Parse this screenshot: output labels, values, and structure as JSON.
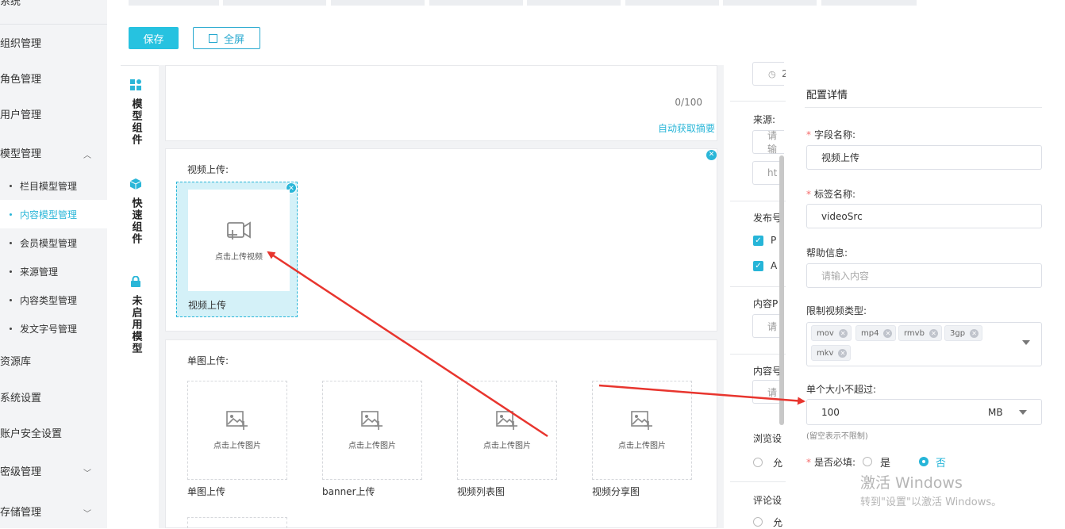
{
  "sidebar": {
    "items": [
      {
        "label": "系统"
      },
      {
        "label": "组织管理"
      },
      {
        "label": "角色管理"
      },
      {
        "label": "用户管理"
      },
      {
        "label": "模型管理"
      },
      {
        "label": "资源库"
      },
      {
        "label": "系统设置"
      },
      {
        "label": "账户安全设置"
      },
      {
        "label": "密级管理"
      },
      {
        "label": "存储管理"
      }
    ],
    "sub_items": [
      {
        "label": "栏目模型管理"
      },
      {
        "label": "内容模型管理"
      },
      {
        "label": "会员模型管理"
      },
      {
        "label": "来源管理"
      },
      {
        "label": "内容类型管理"
      },
      {
        "label": "发文字号管理"
      }
    ]
  },
  "toolbar": {
    "save_label": "保存",
    "fullscreen_label": "全屏"
  },
  "components_panel": {
    "model": "模型组件",
    "quick": "快速组件",
    "disabled": "未启用模型"
  },
  "canvas": {
    "summary_counter": "0/100",
    "auto_summary_link": "自动获取摘要",
    "video_section_label": "视频上传:",
    "video_upload_text": "点击上传视频",
    "video_caption": "视频上传",
    "image_section_label": "单图上传:",
    "image_uploads": [
      {
        "text": "点击上传图片",
        "caption": "单图上传"
      },
      {
        "text": "点击上传图片",
        "caption": "banner上传"
      },
      {
        "text": "点击上传图片",
        "caption": "视频列表图"
      },
      {
        "text": "点击上传图片",
        "caption": "视频分享图"
      }
    ]
  },
  "right_form": {
    "time_partial": "2",
    "source_label": "来源:",
    "source_input_partial": "请输",
    "url_input_partial": "ht",
    "publish_label": "发布号",
    "check1": "P",
    "check2": "A",
    "content_label1": "内容P",
    "content_input1": "请",
    "content_label2": "内容号",
    "content_input2": "请",
    "browse_label": "浏览设",
    "browse_radio": "允",
    "comment_label": "评论设",
    "comment_radio": "允"
  },
  "config": {
    "title": "配置详情",
    "field_name_label": "字段名称:",
    "field_name_value": "视频上传",
    "tag_name_label": "标签名称:",
    "tag_name_value": "videoSrc",
    "help_label": "帮助信息:",
    "help_placeholder": "请输入内容",
    "video_types_label": "限制视频类型:",
    "video_types": [
      "mov",
      "mp4",
      "rmvb",
      "3gp",
      "mkv"
    ],
    "max_size_label": "单个大小不超过:",
    "max_size_value": "100",
    "max_size_unit": "MB",
    "max_size_hint": "(留空表示不限制)",
    "required_label": "是否必填:",
    "required_yes": "是",
    "required_no": "否"
  },
  "watermark": {
    "line1": "激活 Windows",
    "line2": "转到\"设置\"以激活 Windows。"
  },
  "colors": {
    "accent": "#26c2e0",
    "required": "#f56c6c",
    "arrow": "#e8352e"
  }
}
